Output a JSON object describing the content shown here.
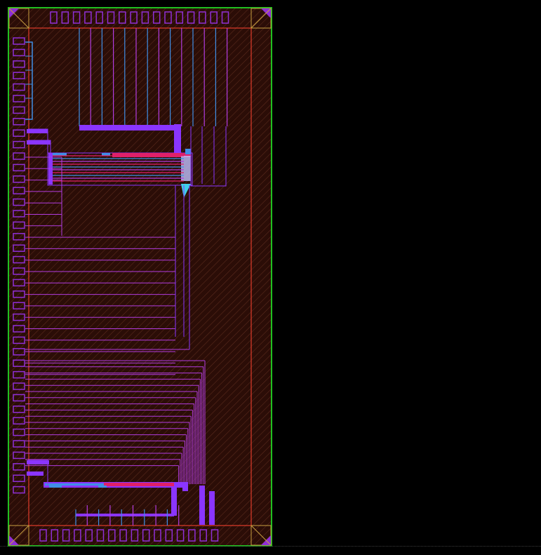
{
  "viewer": {
    "background": "#000000"
  },
  "colors": {
    "die_fill": "#2b0d07",
    "hatch": "#5a2a1c",
    "outline": "#20c020",
    "core_ring": "#e23c2c",
    "corner_diag": "#c8a040",
    "pad": "#8f2fd6",
    "metal1": "#3f8fe6",
    "metal2": "#8a35ff",
    "metal3": "#e0206a",
    "metal_violet": "#b23ce0",
    "via_cyan": "#3fcfe8",
    "selection": "#c0c0ff"
  },
  "layout": {
    "top_pad_count": 16,
    "bottom_pad_count": 16,
    "left_pad_count": 40,
    "upper_fanout_lines": 20,
    "lower_fanout_lines": 18,
    "top_feed_lines": 14,
    "bottom_feed_lines": 10
  }
}
